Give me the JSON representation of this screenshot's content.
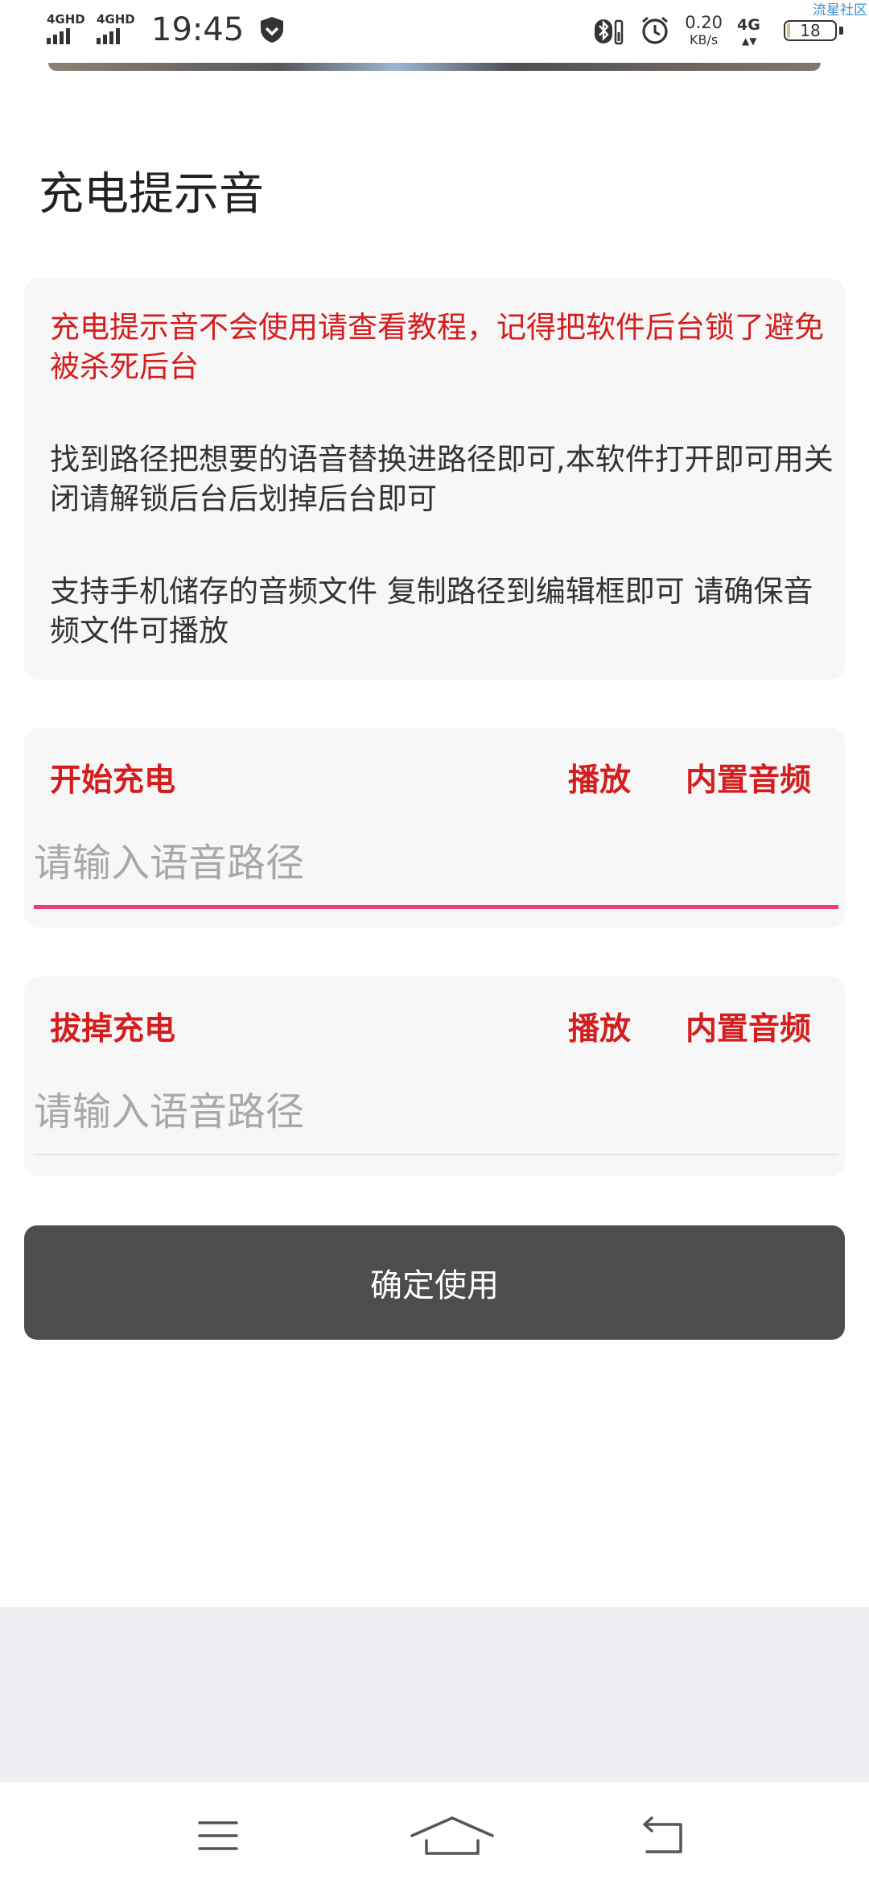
{
  "status_bar": {
    "network_1": "4GHD",
    "network_2": "4GHD",
    "time": "19:45",
    "speed_value": "0.20",
    "speed_unit": "KB/s",
    "network_right": "4G",
    "battery_level": "18",
    "watermark": "流星社区"
  },
  "page": {
    "title": "充电提示音"
  },
  "info": {
    "warning": "充电提示音不会使用请查看教程，记得把软件后台锁了避免被杀死后台",
    "paragraph_1": "找到路径把想要的语音替换进路径即可,本软件打开即可用关闭请解锁后台后划掉后台即可",
    "paragraph_2": "支持手机储存的音频文件 复制路径到编辑框即可 请确保音频文件可播放"
  },
  "start_charging": {
    "label": "开始充电",
    "play_label": "播放",
    "builtin_label": "内置音频",
    "input_value": "",
    "input_placeholder": "请输入语音路径"
  },
  "unplug_charging": {
    "label": "拔掉充电",
    "play_label": "播放",
    "builtin_label": "内置音频",
    "input_value": "",
    "input_placeholder": "请输入语音路径"
  },
  "confirm_button": {
    "label": "确定使用"
  },
  "colors": {
    "accent_red": "#d41e1e",
    "focus_underline": "#e8407a",
    "button_bg": "#4d4d4d"
  },
  "icons": {
    "nav_menu": "menu-icon",
    "nav_home": "home-icon",
    "nav_back": "back-icon"
  }
}
